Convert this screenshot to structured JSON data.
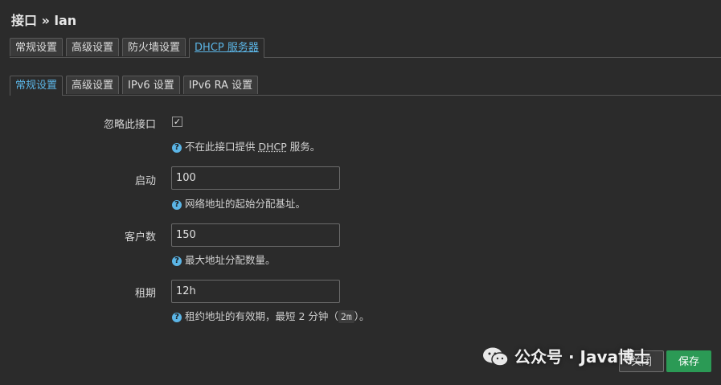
{
  "page": {
    "title": "接口 » lan"
  },
  "main_tabs": [
    {
      "label": "常规设置"
    },
    {
      "label": "高级设置"
    },
    {
      "label": "防火墙设置"
    },
    {
      "label": "DHCP 服务器"
    }
  ],
  "sub_tabs": [
    {
      "label": "常规设置"
    },
    {
      "label": "高级设置"
    },
    {
      "label": "IPv6 设置"
    },
    {
      "label": "IPv6 RA 设置"
    }
  ],
  "form": {
    "ignore": {
      "label": "忽略此接口",
      "checked": true,
      "hint_prefix": "不在此接口提供 ",
      "hint_abbr": "DHCP",
      "hint_suffix": " 服务。"
    },
    "start": {
      "label": "启动",
      "value": "100",
      "hint": "网络地址的起始分配基址。"
    },
    "limit": {
      "label": "客户数",
      "value": "150",
      "hint": "最大地址分配数量。"
    },
    "leasetime": {
      "label": "租期",
      "value": "12h",
      "hint_prefix": "租约地址的有效期，最短 2 分钟（",
      "hint_code": "2m",
      "hint_suffix": "）。"
    }
  },
  "help_glyph": "?",
  "check_glyph": "✓",
  "buttons": {
    "dismiss": "关闭",
    "save": "保存"
  },
  "watermark": {
    "text": "公众号 · Java博士",
    "icon": "wechat-icon"
  },
  "colors": {
    "accent": "#5bb5e6",
    "save": "#2b9a55",
    "background": "#2b2b2b"
  }
}
